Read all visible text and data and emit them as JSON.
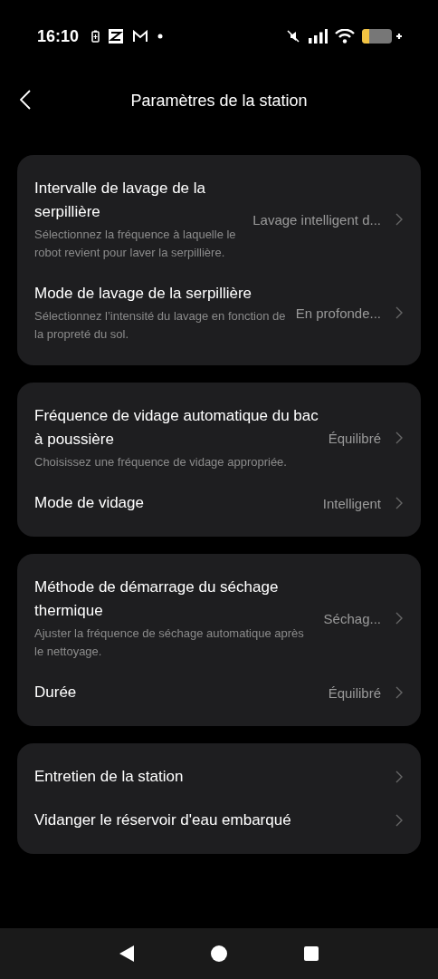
{
  "status_bar": {
    "time": "16:10"
  },
  "header": {
    "title": "Paramètres de la station"
  },
  "sections": [
    {
      "rows": [
        {
          "title": "Intervalle de lavage de la serpillière",
          "description": "Sélectionnez la fréquence à laquelle le robot revient pour laver la serpillière.",
          "value": "Lavage intelligent d..."
        },
        {
          "title": "Mode de lavage de la serpillière",
          "description": "Sélectionnez l’intensité du lavage en fonction de la propreté du sol.",
          "value": "En profonde..."
        }
      ]
    },
    {
      "rows": [
        {
          "title": "Fréquence de vidage automatique du bac à poussière",
          "description": "Choisissez une fréquence de vidage appropriée.",
          "value": "Équilibré"
        },
        {
          "title": "Mode de vidage",
          "value": "Intelligent"
        }
      ]
    },
    {
      "rows": [
        {
          "title": "Méthode de démarrage du séchage thermique",
          "description": "Ajuster la fréquence de séchage automatique après le nettoyage.",
          "value": "Séchag..."
        },
        {
          "title": "Durée",
          "value": "Équilibré"
        }
      ]
    },
    {
      "rows": [
        {
          "title": "Entretien de la station"
        },
        {
          "title": "Vidanger le réservoir d'eau embarqué"
        }
      ]
    }
  ]
}
